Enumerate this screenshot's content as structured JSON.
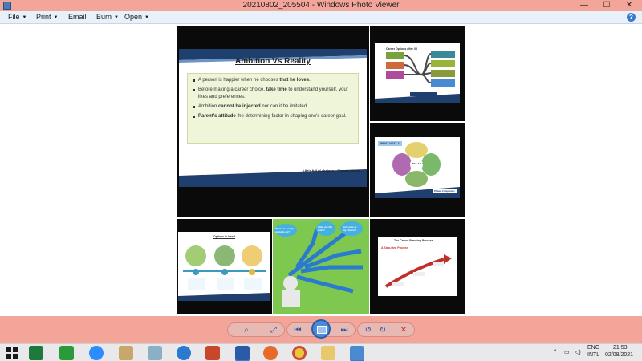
{
  "window": {
    "title": "20210802_205504 - Windows Photo Viewer",
    "controls": {
      "minimize": "—",
      "maximize": "☐",
      "close": "✕"
    }
  },
  "menu": {
    "file": "File",
    "print": "Print",
    "email": "Email",
    "burn": "Burn",
    "open": "Open",
    "help": "?"
  },
  "slides": {
    "main": {
      "title": "Ambition Vs Reality",
      "bullets": [
        {
          "pre": "A person is happier when he chooses ",
          "bold": "that he loves",
          "post": "."
        },
        {
          "pre": "Before making a career choice, ",
          "bold": "take time",
          "post": " to understand yourself, your likes and preferences."
        },
        {
          "pre": "Ambition ",
          "bold": "cannot be injected",
          "post": " nor can it be imitated."
        },
        {
          "pre": "",
          "bold": "Parent's attitude",
          "post": " the determining factor in shaping one's career goal."
        }
      ],
      "footer": "Life's full of choices... Choose wisely..."
    },
    "career_options": {
      "title": "Career Options after XII"
    },
    "what_next": {
      "label": "WHAT NEXT ?",
      "center": "Who Am I",
      "caption": "Phase Companies"
    },
    "options_in_hand": {
      "title": "Options in Hand"
    },
    "questions": {
      "bubbles": [
        "What am I really going to do?",
        "What are the risks?",
        "Am I sure of my choice?"
      ]
    },
    "planning": {
      "title": "The Career Planning Process",
      "subtitle": "A Step-step Process"
    }
  },
  "controls": {
    "zoom": "⌕",
    "fit": "⤢",
    "prev": "⏮",
    "next": "⏭",
    "rotate_left": "↺",
    "rotate_right": "↻",
    "delete": "✕"
  },
  "taskbar": {
    "language_top": "ENG",
    "language_bottom": "INTL",
    "time": "21:53",
    "date": "02/08/2021"
  },
  "colors": {
    "title_bar": "#f4a59a",
    "menu_bar": "#e8f0fa",
    "slide_banner": "#1f3f6e",
    "bullets_bg": "#eef5d8"
  }
}
